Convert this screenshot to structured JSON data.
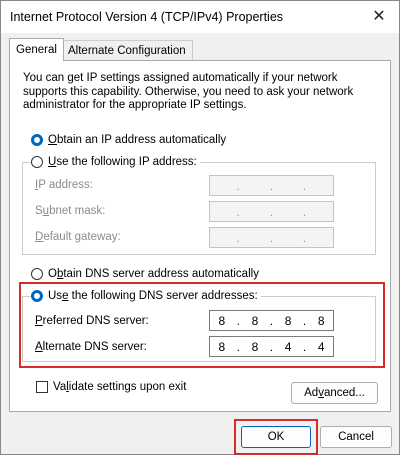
{
  "window": {
    "title": "Internet Protocol Version 4 (TCP/IPv4) Properties",
    "close_glyph": "✕"
  },
  "tabs": [
    {
      "label": "General",
      "active": true
    },
    {
      "label": "Alternate Configuration",
      "active": false
    }
  ],
  "description": "You can get IP settings assigned automatically if your network supports this capability. Otherwise, you need to ask your network administrator for the appropriate IP settings.",
  "ip_section": {
    "auto_radio": {
      "accel": "O",
      "rest": "btain an IP address automatically",
      "checked": true
    },
    "manual_radio": {
      "accel": "U",
      "rest": "se the following IP address:",
      "checked": false
    },
    "fields": [
      {
        "accel": "I",
        "rest": "P address:",
        "octets": [
          "",
          "",
          "",
          ""
        ],
        "enabled": false
      },
      {
        "accel": "",
        "pre": "S",
        "accel2": "u",
        "rest": "bnet mask:",
        "octets": [
          "",
          "",
          "",
          ""
        ],
        "enabled": false
      },
      {
        "accel": "D",
        "rest": "efault gateway:",
        "octets": [
          "",
          "",
          "",
          ""
        ],
        "enabled": false
      }
    ]
  },
  "dns_section": {
    "auto_radio": {
      "pre": "O",
      "accel": "b",
      "rest": "tain DNS server address automatically",
      "checked": false
    },
    "manual_radio": {
      "pre": "Us",
      "accel": "e",
      "rest": " the following DNS server addresses:",
      "checked": true
    },
    "preferred": {
      "accel": "P",
      "rest": "referred DNS server:",
      "octets": [
        "8",
        "8",
        "8",
        "8"
      ]
    },
    "alternate": {
      "accel": "A",
      "rest": "lternate DNS server:",
      "octets": [
        "8",
        "8",
        "4",
        "4"
      ]
    }
  },
  "validate": {
    "pre": "Va",
    "accel": "l",
    "rest": "idate settings upon exit",
    "checked": false
  },
  "buttons": {
    "advanced": {
      "pre": "Ad",
      "accel": "v",
      "rest": "anced..."
    },
    "ok": "OK",
    "cancel": "Cancel"
  },
  "colors": {
    "accent": "#0067c0",
    "highlight": "#d62b2b"
  }
}
